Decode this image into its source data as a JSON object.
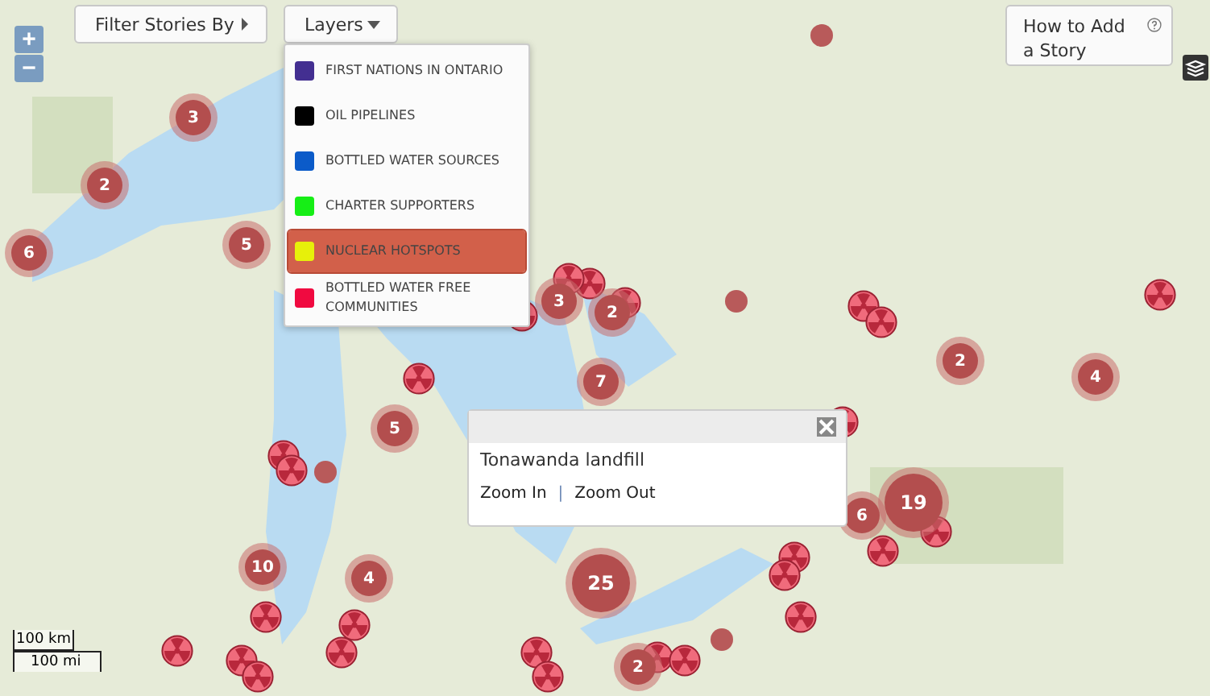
{
  "toolbar": {
    "filter_button": "Filter Stories By",
    "layers_button": "Layers",
    "help_button": "How to Add a Story"
  },
  "zoom_controls": {
    "zoom_in": "+",
    "zoom_out": "−"
  },
  "layers_menu": [
    {
      "label": "FIRST NATIONS IN ONTARIO",
      "color": "#432f91",
      "selected": false
    },
    {
      "label": "OIL PIPELINES",
      "color": "#000000",
      "selected": false
    },
    {
      "label": "BOTTLED WATER SOURCES",
      "color": "#0b5bc9",
      "selected": false
    },
    {
      "label": "CHARTER SUPPORTERS",
      "color": "#16ee16",
      "selected": false
    },
    {
      "label": "NUCLEAR HOTSPOTS",
      "color": "#e7f00a",
      "selected": true
    },
    {
      "label": "BOTTLED WATER FREE COMMUNITIES",
      "color": "#f00a40",
      "selected": false
    }
  ],
  "clusters": [
    "3",
    "2",
    "6",
    "5",
    "3",
    "2",
    "7",
    "5",
    "2",
    "4",
    "19",
    "6",
    "10",
    "4",
    "25",
    "2"
  ],
  "popup": {
    "title": "Tonawanda landfill",
    "links": [
      "Zoom In",
      "Zoom Out"
    ],
    "separator": "|"
  },
  "scale": {
    "metric": "100 km",
    "imperial": "100 mi"
  }
}
